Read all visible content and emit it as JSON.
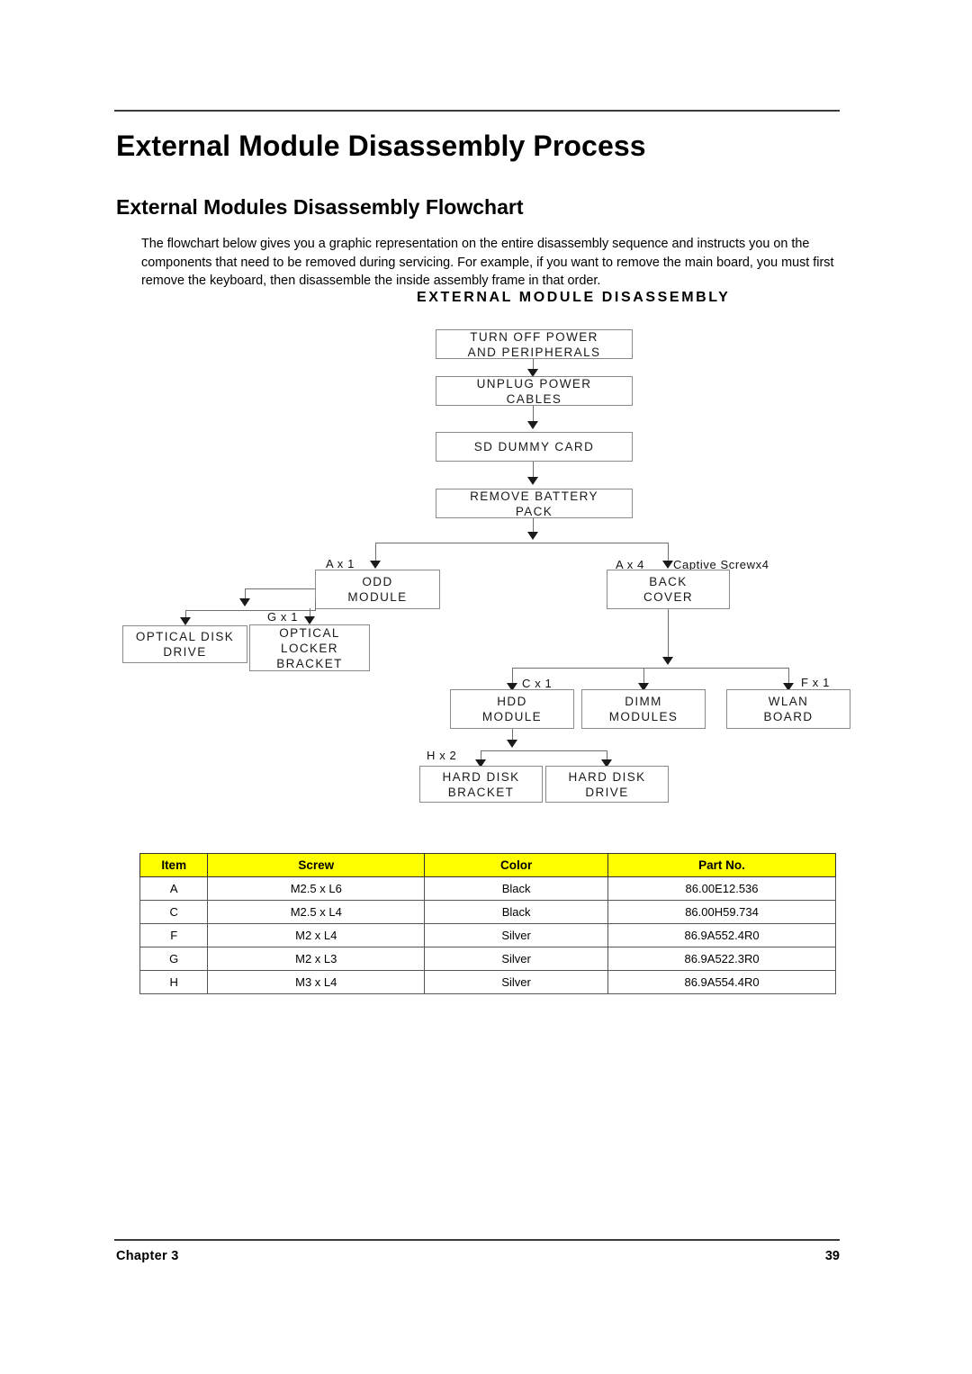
{
  "page": {
    "title": "External Module Disassembly Process",
    "subtitle": "External Modules Disassembly Flowchart",
    "intro": "The flowchart below gives you a graphic representation on the entire disassembly sequence and instructs you on the components that need to be removed during servicing. For example, if you want to remove the main board, you must first remove the keyboard, then disassemble the inside assembly frame in that order."
  },
  "flowchart": {
    "title": "EXTERNAL  MODULE  DISASSEMBLY",
    "nodes": {
      "turn_off": {
        "line1": "TURN OFF POWER",
        "line2": "AND PERIPHERALS"
      },
      "unplug": {
        "line1": "UNPLUG POWER",
        "line2": "CABLES"
      },
      "sd_card": {
        "line1": "SD DUMMY CARD"
      },
      "battery": {
        "line1": "REMOVE BATTERY",
        "line2": "PACK"
      },
      "odd_module": {
        "line1": "ODD",
        "line2": "MODULE"
      },
      "back_cover": {
        "line1": "BACK",
        "line2": "COVER"
      },
      "optical_disk_drive": {
        "line1": "OPTICAL DISK",
        "line2": "DRIVE"
      },
      "optical_locker_bracket": {
        "line1": "OPTICAL",
        "line2": "LOCKER",
        "line3": "BRACKET"
      },
      "hdd_module": {
        "line1": "HDD",
        "line2": "MODULE"
      },
      "dimm_modules": {
        "line1": "DIMM",
        "line2": "MODULES"
      },
      "wlan_board": {
        "line1": "WLAN",
        "line2": "BOARD"
      },
      "hard_disk_bracket": {
        "line1": "HARD  DISK",
        "line2": "BRACKET"
      },
      "hard_disk_drive": {
        "line1": "HARD  DISK",
        "line2": "DRIVE"
      }
    },
    "edge_labels": {
      "odd_screw": "A x 1",
      "back_cover_screw": "A x 4",
      "back_cover_captive": "Captive Screwx4",
      "locker_screw": "G x 1",
      "hdd_screw": "C x 1",
      "wlan_screw": "F x 1",
      "hdd_bracket_screw": "H x 2"
    }
  },
  "table": {
    "headers": [
      "Item",
      "Screw",
      "Color",
      "Part No."
    ],
    "rows": [
      [
        "A",
        "M2.5 x L6",
        "Black",
        "86.00E12.536"
      ],
      [
        "C",
        "M2.5 x L4",
        "Black",
        "86.00H59.734"
      ],
      [
        "F",
        "M2 x L4",
        "Silver",
        "86.9A552.4R0"
      ],
      [
        "G",
        "M2 x L3",
        "Silver",
        "86.9A522.3R0"
      ],
      [
        "H",
        "M3 x L4",
        "Silver",
        "86.9A554.4R0"
      ]
    ],
    "header_bg": "#ffff00"
  },
  "footer": {
    "chapter": "Chapter 3",
    "page_number": "39"
  }
}
